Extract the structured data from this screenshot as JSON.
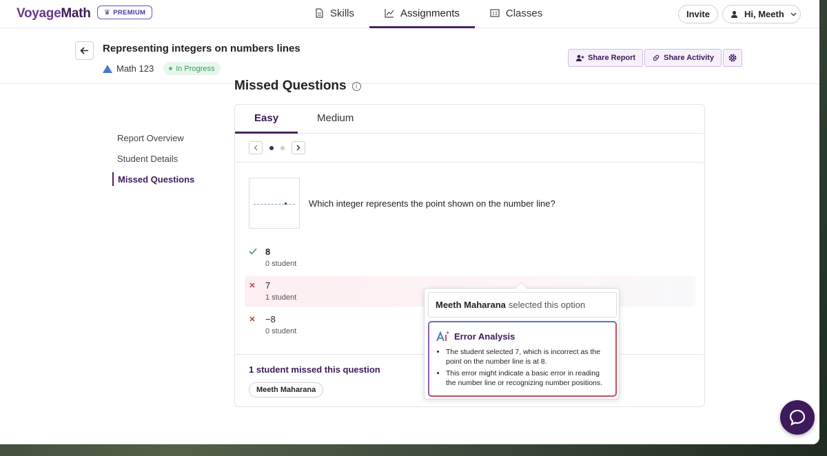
{
  "brand": {
    "logo_prefix": "Voyage",
    "logo_suffix": "Math",
    "premium_label": "PREMIUM"
  },
  "nav": {
    "tabs": [
      {
        "label": "Skills",
        "active": false
      },
      {
        "label": "Assignments",
        "active": true
      },
      {
        "label": "Classes",
        "active": false
      }
    ],
    "invite_label": "Invite",
    "user_greeting": "Hi, Meeth"
  },
  "assignment": {
    "title": "Representing integers on numbers lines",
    "course": "Math 123",
    "status": "In Progress",
    "share_report_label": "Share Report",
    "share_activity_label": "Share Activity"
  },
  "sidebar": {
    "items": [
      {
        "label": "Report Overview",
        "active": false
      },
      {
        "label": "Student Details",
        "active": false
      },
      {
        "label": "Missed Questions",
        "active": true
      }
    ]
  },
  "section_title": "Missed Questions",
  "difficulty_tabs": [
    {
      "label": "Easy",
      "active": true
    },
    {
      "label": "Medium",
      "active": false
    }
  ],
  "pager": {
    "current": 1,
    "total": 2
  },
  "question": {
    "text": "Which integer represents the point shown on the number line?",
    "options": [
      {
        "value": "8",
        "count": "0 student",
        "correct": true,
        "selected": false
      },
      {
        "value": "7",
        "count": "1 student",
        "correct": false,
        "selected": true
      },
      {
        "value": "−8",
        "count": "0 student",
        "correct": false,
        "selected": false
      }
    ],
    "missed_summary": "1 student missed this question",
    "missed_students": [
      "Meeth Maharana"
    ]
  },
  "popover": {
    "student_name": "Meeth Maharana",
    "selected_text": "selected this option",
    "analysis_title": "Error Analysis",
    "analysis_points": [
      "The student selected 7, which is incorrect as the point on the number line is at 8.",
      "This error might indicate a basic error in reading the number line or recognizing number positions."
    ]
  },
  "colors": {
    "brand": "#3d1a5b",
    "correct": "#3f9a5d",
    "incorrect": "#c0392b",
    "status_bg": "#e7f6ec"
  }
}
